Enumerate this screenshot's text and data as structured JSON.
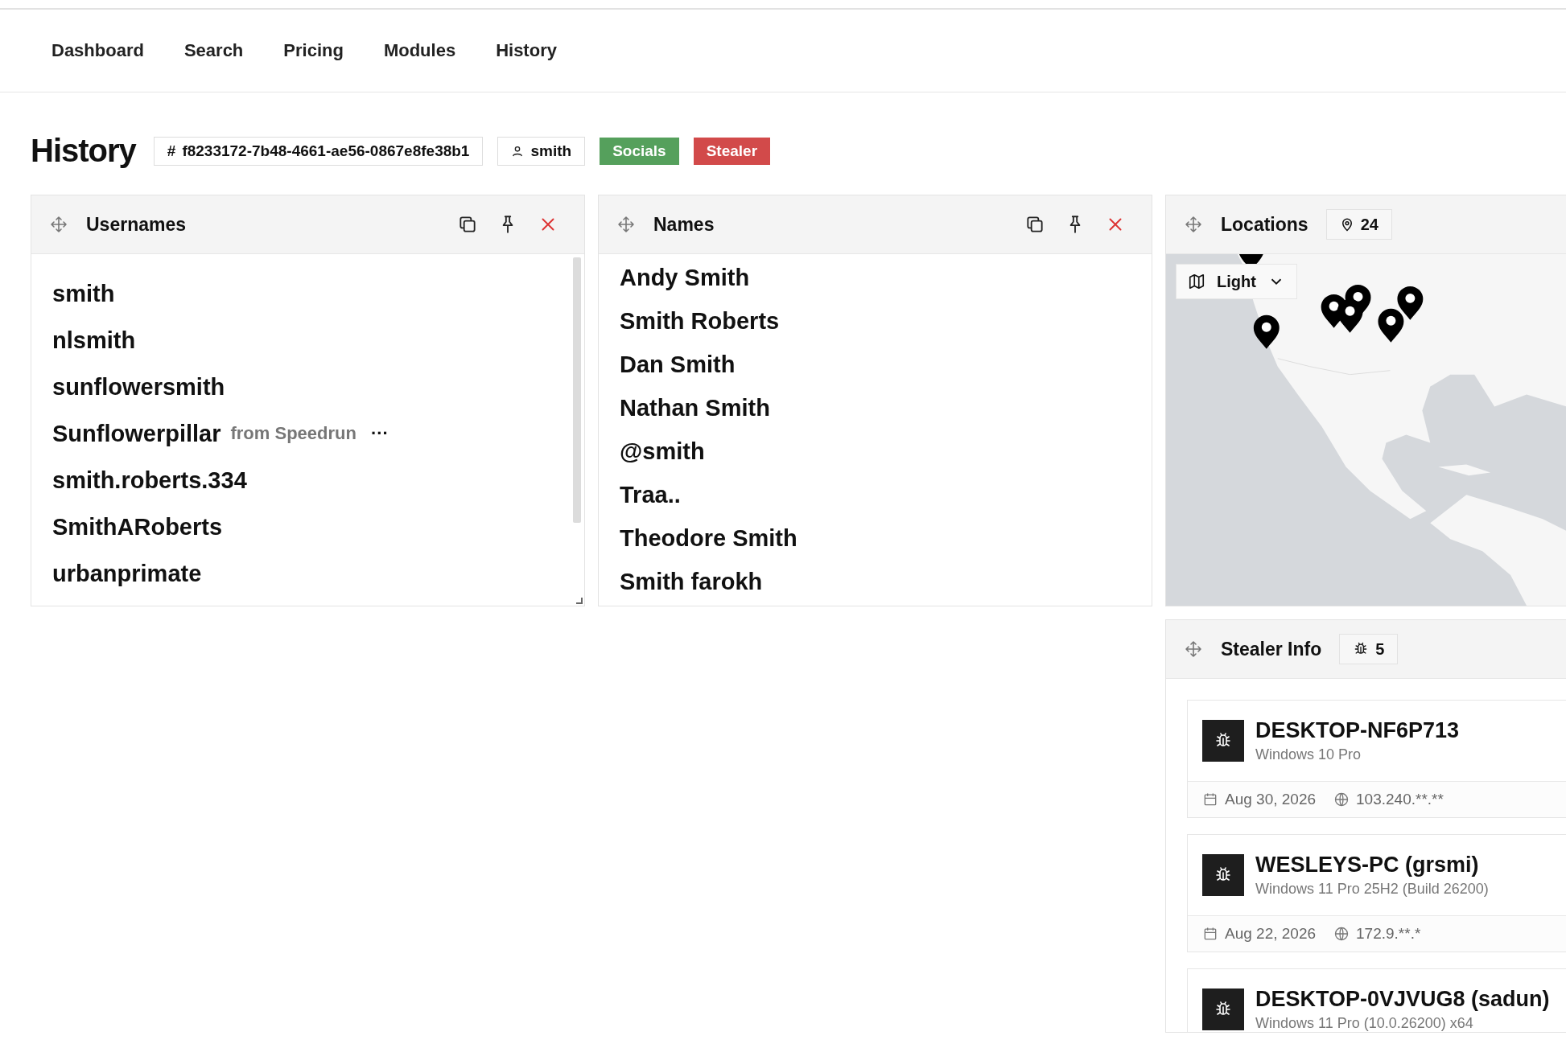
{
  "nav": [
    {
      "label": "Dashboard"
    },
    {
      "label": "Search"
    },
    {
      "label": "Pricing"
    },
    {
      "label": "Modules"
    },
    {
      "label": "History"
    }
  ],
  "header": {
    "title": "History",
    "id_prefix": "#",
    "id": "f8233172-7b48-4661-ae56-0867e8fe38b1",
    "user": "smith",
    "tags": [
      {
        "label": "Socials",
        "color": "#55a05c"
      },
      {
        "label": "Stealer",
        "color": "#d24a4a"
      }
    ]
  },
  "usernames": {
    "title": "Usernames",
    "items": [
      {
        "name": "smith"
      },
      {
        "name": "nlsmith"
      },
      {
        "name": "sunflowersmith"
      },
      {
        "name": "Sunflowerpillar",
        "source": "from Speedrun",
        "more": "···"
      },
      {
        "name": "smith.roberts.334"
      },
      {
        "name": "SmithARoberts"
      },
      {
        "name": "urbanprimate"
      }
    ]
  },
  "names": {
    "title": "Names",
    "items": [
      "Andy Smith",
      "Smith Roberts",
      "Dan Smith",
      "Nathan Smith",
      "@smith",
      "Traa..",
      "Theodore Smith",
      "Smith farokh"
    ]
  },
  "locations": {
    "title": "Locations",
    "count": "24",
    "map_style": "Light"
  },
  "stealer": {
    "title": "Stealer Info",
    "count": "5",
    "entries": [
      {
        "host": "DESKTOP-NF6P713",
        "os": "Windows 10 Pro",
        "date": "Aug 30, 2026",
        "ip": "103.240.**.**"
      },
      {
        "host": "WESLEYS-PC (grsmi)",
        "os": "Windows 11 Pro 25H2 (Build 26200)",
        "date": "Aug 22, 2026",
        "ip": "172.9.**.*"
      },
      {
        "host": "DESKTOP-0VJVUG8 (sadun)",
        "os": "Windows 11 Pro (10.0.26200) x64"
      }
    ]
  }
}
